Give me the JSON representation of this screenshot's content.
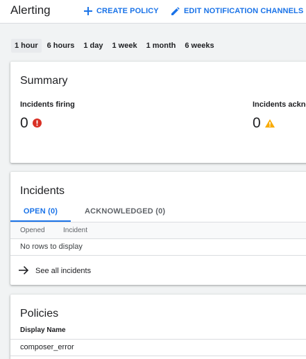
{
  "header": {
    "title": "Alerting",
    "create_policy_label": "CREATE POLICY",
    "edit_channels_label": "EDIT NOTIFICATION CHANNELS"
  },
  "time_range": {
    "options": [
      "1 hour",
      "6 hours",
      "1 day",
      "1 week",
      "1 month",
      "6 weeks"
    ],
    "selected": "1 hour"
  },
  "summary": {
    "title": "Summary",
    "firing_label": "Incidents firing",
    "firing_value": "0",
    "ack_label": "Incidents ackno",
    "ack_value": "0"
  },
  "incidents": {
    "title": "Incidents",
    "tabs": [
      "OPEN (0)",
      "ACKNOWLEDGED (0)"
    ],
    "active_tab": "OPEN (0)",
    "columns": [
      "Opened",
      "Incident"
    ],
    "empty_text": "No rows to display",
    "see_all_label": "See all incidents"
  },
  "policies": {
    "title": "Policies",
    "columns": [
      "Display Name"
    ],
    "rows": [
      "composer_error"
    ]
  },
  "colors": {
    "accent": "#1a73e8",
    "error": "#d93025",
    "warning": "#f9ab00"
  },
  "icons": {
    "create": "plus-icon",
    "edit": "pencil-icon",
    "firing": "error-icon",
    "ack": "warning-icon",
    "see_all": "arrow-right-icon"
  }
}
